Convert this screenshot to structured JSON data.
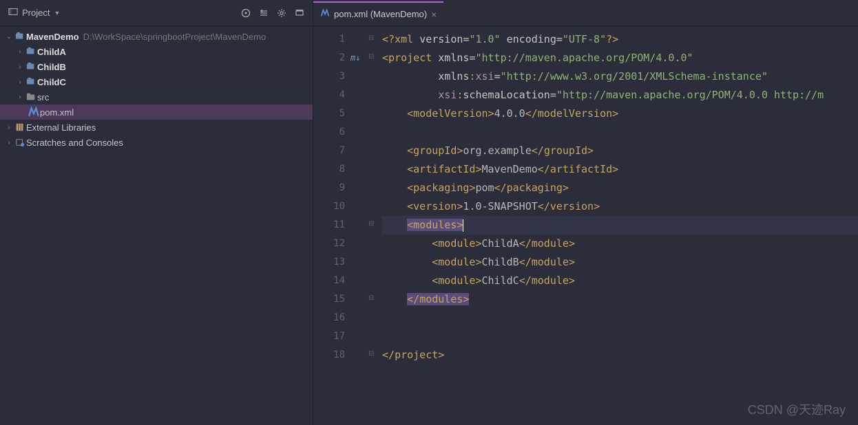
{
  "sidebar": {
    "title": "Project",
    "icons": [
      "target-icon",
      "collapse-icon",
      "gear-icon",
      "hide-icon"
    ],
    "project": {
      "name": "MavenDemo",
      "path": "D:\\WorkSpace\\springbootProject\\MavenDemo"
    },
    "children": [
      {
        "name": "ChildA",
        "kind": "module"
      },
      {
        "name": "ChildB",
        "kind": "module"
      },
      {
        "name": "ChildC",
        "kind": "module"
      },
      {
        "name": "src",
        "kind": "folder"
      },
      {
        "name": "pom.xml",
        "kind": "maven",
        "selected": true
      }
    ],
    "top_level": [
      {
        "name": "External Libraries",
        "kind": "lib"
      },
      {
        "name": "Scratches and Consoles",
        "kind": "scratch"
      }
    ]
  },
  "editor": {
    "tab": {
      "label": "pom.xml (MavenDemo)"
    },
    "lines": 18,
    "gutter_marker": {
      "line": 2,
      "text": "m↓"
    },
    "bulb_line": 11,
    "code": {
      "l1": {
        "pi": "<?xml version=\"1.0\" encoding=\"UTF-8\"?>"
      },
      "l2": {
        "tag": "project",
        "attrs": [
          {
            "name": "xmlns",
            "value": "http://maven.apache.org/POM/4.0.0"
          }
        ]
      },
      "l3": {
        "attrs": [
          {
            "ns": "xmlns",
            "local": "xsi",
            "value": "http://www.w3.org/2001/XMLSchema-instance"
          }
        ]
      },
      "l4": {
        "attrs": [
          {
            "ns": "xsi",
            "local": "schemaLocation",
            "value": "http://maven.apache.org/POM/4.0.0 http://m"
          }
        ],
        "close": ">"
      },
      "l5": {
        "tag": "modelVersion",
        "text": "4.0.0"
      },
      "l7": {
        "tag": "groupId",
        "text": "org.example"
      },
      "l8": {
        "tag": "artifactId",
        "text": "MavenDemo"
      },
      "l9": {
        "tag": "packaging",
        "text": "pom"
      },
      "l10": {
        "tag": "version",
        "text": "1.0-SNAPSHOT"
      },
      "l11": {
        "openTag": "modules"
      },
      "l12": {
        "tag": "module",
        "text": "ChildA"
      },
      "l13": {
        "tag": "module",
        "text": "ChildB"
      },
      "l14": {
        "tag": "module",
        "text": "ChildC"
      },
      "l15": {
        "closeTag": "modules"
      },
      "l18": {
        "closeTag": "project"
      }
    }
  },
  "watermark": "CSDN @天迹Ray"
}
